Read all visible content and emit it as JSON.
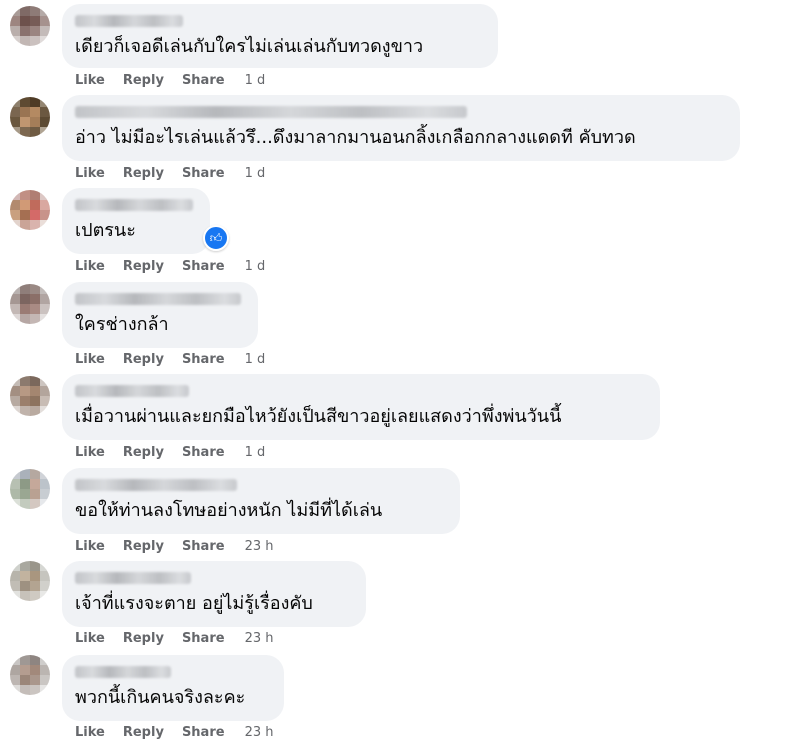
{
  "labels": {
    "like": "Like",
    "reply": "Reply",
    "share": "Share"
  },
  "comments": [
    {
      "text": "เดียวก็เจอดีเล่นกับใครไม่เล่นเล่นกับทวดงูขาว",
      "time": "1 d"
    },
    {
      "text": "อ่าว  ไม่มีอะไรเล่นแล้วรึ...ดึงมาลากมานอนกลิ้งเกลือกกลางแดดที คับทวด",
      "time": "1 d"
    },
    {
      "text": "เปตรนะ",
      "time": "1 d",
      "reaction": "like-icon"
    },
    {
      "text": "ใครช่างกล้า",
      "time": "1 d"
    },
    {
      "text": "เมื่อวานผ่านและยกมือไหว้ยังเป็นสีขาวอยู่เลยแสดงว่าพึ่งพ่นวันนี้",
      "time": "1 d"
    },
    {
      "text": "ขอให้ท่านลงโทษอย่างหนัก  ไม่มีที่ได้เล่น",
      "time": "23 h"
    },
    {
      "text": "เจ้าที่แรงจะตาย  อยู่ไม่รู้เรื่องคับ",
      "time": "23 h"
    },
    {
      "text": "พวกนี้เกินคนจริงละคะ",
      "time": "23 h"
    }
  ],
  "colors": {
    "bubble": "#f0f2f5",
    "action_text": "#65676b",
    "like_blue": "#1877f2"
  }
}
